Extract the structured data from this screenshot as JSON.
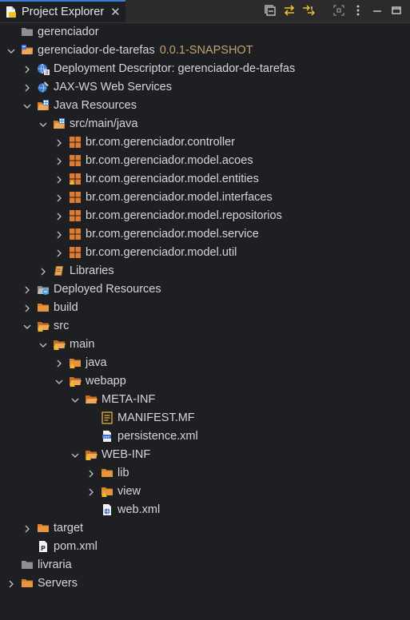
{
  "view": {
    "title": "Project Explorer",
    "close_glyph": "✕",
    "toolbar_icons": [
      "collapse-all-icon",
      "link-with-editor-icon",
      "filter-icon",
      "focus-icon",
      "view-menu-icon",
      "minimize-icon",
      "maximize-icon"
    ]
  },
  "tree": [
    {
      "label": "gerenciador",
      "depth": 0,
      "chevron": "none",
      "icon": "closed-project-folder"
    },
    {
      "label": "gerenciador-de-tarefas",
      "version": "0.0.1-SNAPSHOT",
      "depth": 0,
      "chevron": "down",
      "icon": "open-project"
    },
    {
      "label": "Deployment Descriptor: gerenciador-de-tarefas",
      "depth": 1,
      "chevron": "right",
      "icon": "deployment-descriptor"
    },
    {
      "label": "JAX-WS Web Services",
      "depth": 1,
      "chevron": "right",
      "icon": "web-services"
    },
    {
      "label": "Java Resources",
      "depth": 1,
      "chevron": "down",
      "icon": "java-resources"
    },
    {
      "label": "src/main/java",
      "depth": 2,
      "chevron": "down",
      "icon": "source-folder"
    },
    {
      "label": "br.com.gerenciador.controller",
      "depth": 3,
      "chevron": "right",
      "icon": "package"
    },
    {
      "label": "br.com.gerenciador.model.acoes",
      "depth": 3,
      "chevron": "right",
      "icon": "package"
    },
    {
      "label": "br.com.gerenciador.model.entities",
      "depth": 3,
      "chevron": "right",
      "icon": "package-warning"
    },
    {
      "label": "br.com.gerenciador.model.interfaces",
      "depth": 3,
      "chevron": "right",
      "icon": "package"
    },
    {
      "label": "br.com.gerenciador.model.repositorios",
      "depth": 3,
      "chevron": "right",
      "icon": "package"
    },
    {
      "label": "br.com.gerenciador.model.service",
      "depth": 3,
      "chevron": "right",
      "icon": "package"
    },
    {
      "label": "br.com.gerenciador.model.util",
      "depth": 3,
      "chevron": "right",
      "icon": "package"
    },
    {
      "label": "Libraries",
      "depth": 2,
      "chevron": "right",
      "icon": "libraries"
    },
    {
      "label": "Deployed Resources",
      "depth": 1,
      "chevron": "right",
      "icon": "deployed-resources"
    },
    {
      "label": "build",
      "depth": 1,
      "chevron": "right",
      "icon": "folder"
    },
    {
      "label": "src",
      "depth": 1,
      "chevron": "down",
      "icon": "folder-open-warning"
    },
    {
      "label": "main",
      "depth": 2,
      "chevron": "down",
      "icon": "folder-open-warning"
    },
    {
      "label": "java",
      "depth": 3,
      "chevron": "right",
      "icon": "folder-warning"
    },
    {
      "label": "webapp",
      "depth": 3,
      "chevron": "down",
      "icon": "folder-open-warning"
    },
    {
      "label": "META-INF",
      "depth": 4,
      "chevron": "down",
      "icon": "folder-open"
    },
    {
      "label": "MANIFEST.MF",
      "depth": 5,
      "chevron": "none",
      "icon": "manifest-file"
    },
    {
      "label": "persistence.xml",
      "depth": 5,
      "chevron": "none",
      "icon": "xml-file"
    },
    {
      "label": "WEB-INF",
      "depth": 4,
      "chevron": "down",
      "icon": "folder-open-warning"
    },
    {
      "label": "lib",
      "depth": 5,
      "chevron": "right",
      "icon": "folder"
    },
    {
      "label": "view",
      "depth": 5,
      "chevron": "right",
      "icon": "folder-warning"
    },
    {
      "label": "web.xml",
      "depth": 5,
      "chevron": "none",
      "icon": "web-xml-file"
    },
    {
      "label": "target",
      "depth": 1,
      "chevron": "right",
      "icon": "folder"
    },
    {
      "label": "pom.xml",
      "depth": 1,
      "chevron": "none",
      "icon": "pom-file"
    },
    {
      "label": "livraria",
      "depth": 0,
      "chevron": "none",
      "icon": "closed-project-folder"
    },
    {
      "label": "Servers",
      "depth": 0,
      "chevron": "right",
      "icon": "folder"
    }
  ],
  "colors": {
    "background": "#1e1f22",
    "text": "#d6d6d6",
    "version": "#c4a36a",
    "folder": "#d9822b",
    "package": "#e07b2f",
    "warning": "#f0c020",
    "active_tab": "#3c7dd9"
  }
}
